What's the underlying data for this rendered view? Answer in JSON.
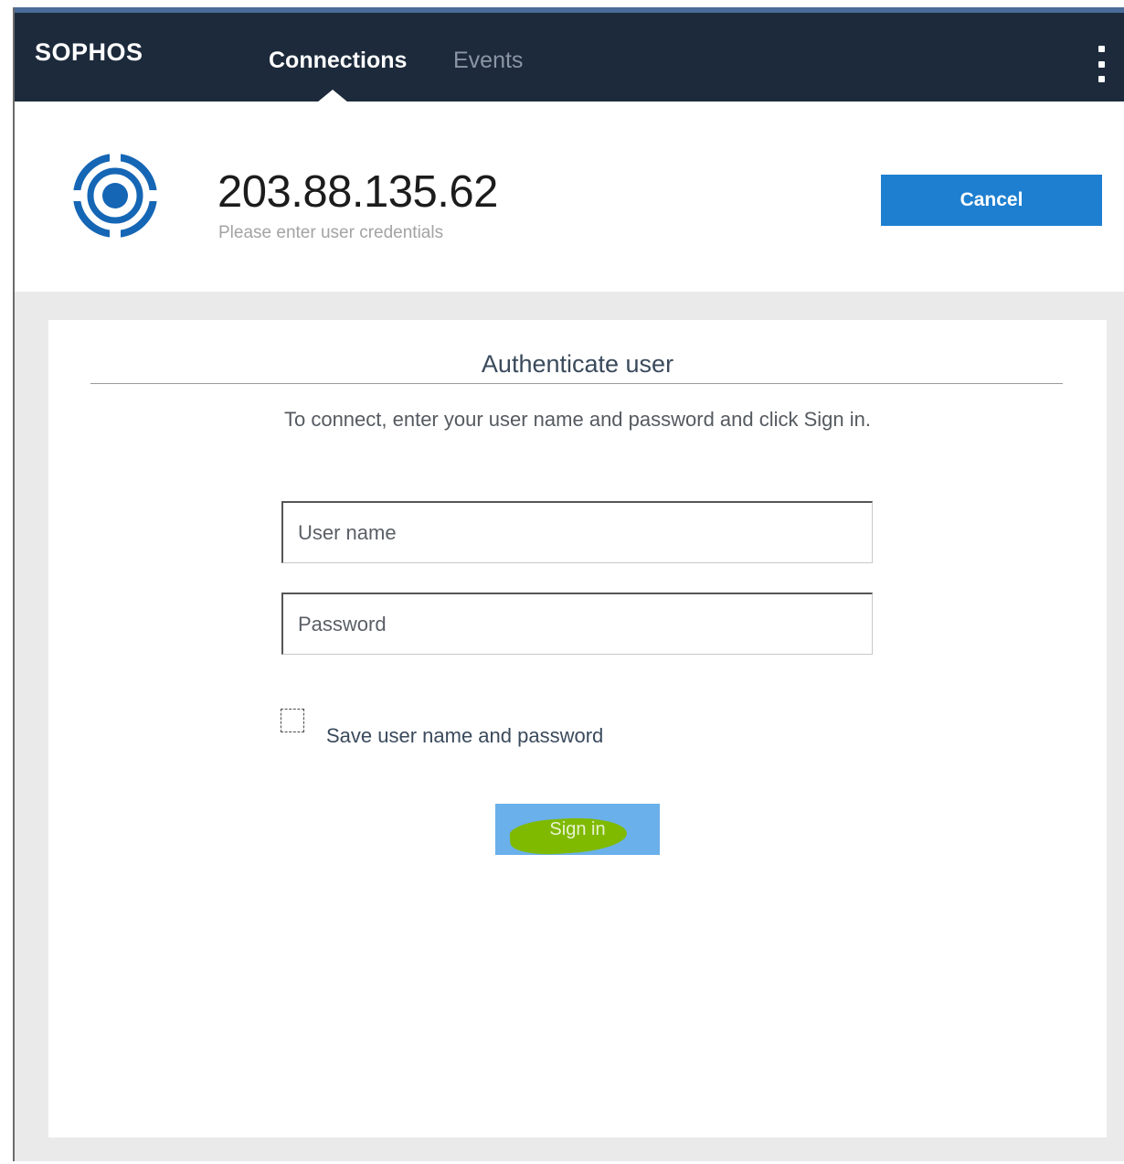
{
  "app": {
    "brand": "SOPHOS"
  },
  "nav": {
    "tabs": [
      {
        "label": "Connections",
        "active": true
      },
      {
        "label": "Events",
        "active": false
      }
    ],
    "menu_icon": "kebab-menu-icon"
  },
  "connection": {
    "address": "203.88.135.62",
    "subtitle": "Please enter user credentials",
    "cancel_label": "Cancel",
    "icon": "target-icon"
  },
  "auth": {
    "title": "Authenticate user",
    "instructions": "To connect, enter your user name and password and click Sign in.",
    "username_placeholder": "User name",
    "password_placeholder": "Password",
    "save_label": "Save user name and password",
    "save_checked": false,
    "signin_label": "Sign in"
  },
  "colors": {
    "navbar": "#1c2a3b",
    "accent": "#1e7fd0",
    "signin_button": "#6ab0ea",
    "highlight_scribble": "#7fba00",
    "background": "#eaeaea"
  }
}
